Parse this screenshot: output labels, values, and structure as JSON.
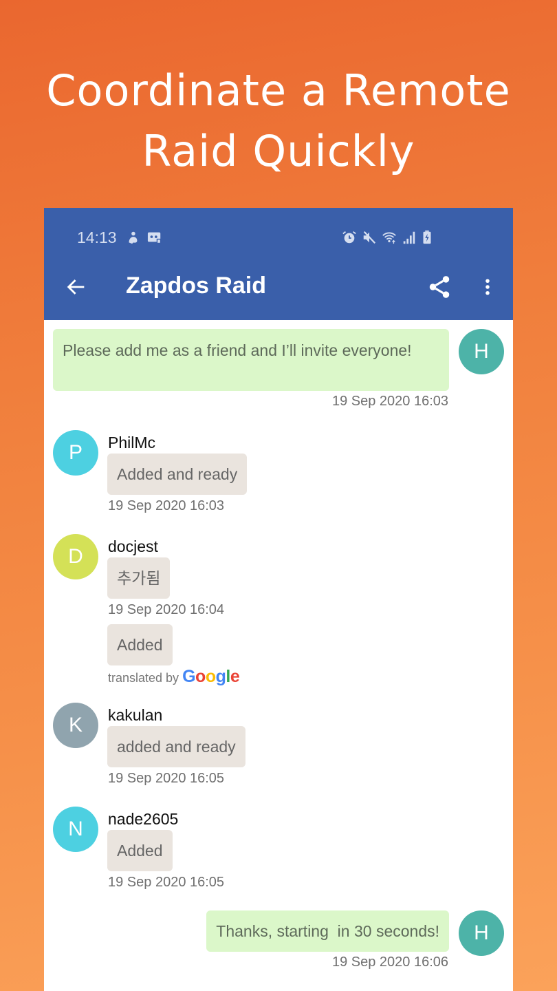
{
  "headline": {
    "line1": "Coordinate a Remote",
    "line2": "Raid Quickly"
  },
  "status_bar": {
    "time": "14:13",
    "left_icons": [
      "notification-app-icon",
      "voicemail-icon"
    ],
    "right_icons": [
      "alarm-icon",
      "mute-icon",
      "wifi-icon",
      "signal-icon",
      "battery-charging-icon"
    ]
  },
  "app_bar": {
    "title": "Zapdos Raid",
    "back_icon": "arrow-back-icon",
    "share_icon": "share-icon",
    "more_icon": "more-vert-icon"
  },
  "colors": {
    "app_bar": "#3A5FAA",
    "outgoing_bubble": "#DBF7C9",
    "incoming_bubble": "#EAE4DE",
    "background_top": "#EA672F",
    "background_bottom": "#FBA25A"
  },
  "messages": [
    {
      "direction": "outgoing",
      "avatar_letter": "H",
      "avatar_color": "#4DB3A8",
      "text": "Please add me as a friend and I’ll invite everyone!",
      "timestamp": "19 Sep 2020 16:03"
    },
    {
      "direction": "incoming",
      "sender": "PhilMc",
      "avatar_letter": "P",
      "avatar_color": "#4DD0E1",
      "text": "Added and ready",
      "timestamp": "19 Sep 2020 16:03"
    },
    {
      "direction": "incoming",
      "sender": "docjest",
      "avatar_letter": "D",
      "avatar_color": "#D4E157",
      "text": "추가됨",
      "timestamp": "19 Sep 2020 16:04",
      "translation": {
        "text": "Added",
        "credit_prefix": "translated by",
        "credit_brand": [
          "G",
          "o",
          "o",
          "g",
          "l",
          "e"
        ]
      }
    },
    {
      "direction": "incoming",
      "sender": "kakulan",
      "avatar_letter": "K",
      "avatar_color": "#90A4AE",
      "text": "added and ready",
      "timestamp": "19 Sep 2020 16:05"
    },
    {
      "direction": "incoming",
      "sender": "nade2605",
      "avatar_letter": "N",
      "avatar_color": "#4DD0E1",
      "text": "Added",
      "timestamp": "19 Sep 2020 16:05"
    },
    {
      "direction": "outgoing",
      "avatar_letter": "H",
      "avatar_color": "#4DB3A8",
      "text": "Thanks, starting  in 30 seconds!",
      "timestamp": "19 Sep 2020 16:06"
    }
  ]
}
